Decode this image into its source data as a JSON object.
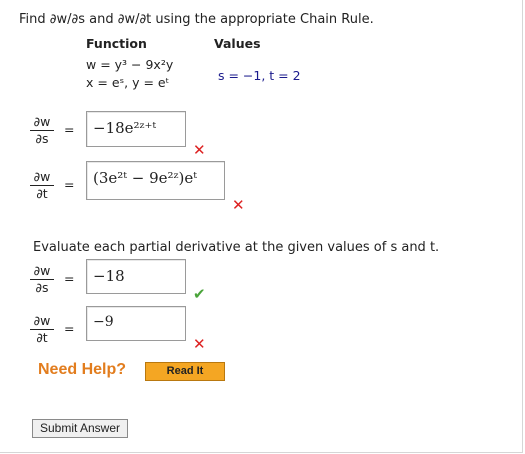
{
  "prompt": "Find ∂w/∂s and ∂w/∂t using the appropriate Chain Rule.",
  "table": {
    "function_header": "Function",
    "values_header": "Values",
    "function_line1": "w = y³ − 9x²y",
    "function_line2": "x = eˢ,  y = eᵗ",
    "values_text": "s = −1,  t = 2"
  },
  "part1": {
    "dw_ds_num": "∂w",
    "dw_ds_den": "∂s",
    "dw_dt_num": "∂w",
    "dw_dt_den": "∂t",
    "equals": "=",
    "answer_ds": "−18e²ᶻ⁺ᵗ",
    "answer_dt": "(3e²ᵗ − 9e²ᶻ)eᵗ",
    "ds_status": "incorrect",
    "dt_status": "incorrect"
  },
  "evaluate_text": "Evaluate each partial derivative at the given values of s and t.",
  "part2": {
    "dw_ds_num": "∂w",
    "dw_ds_den": "∂s",
    "dw_dt_num": "∂w",
    "dw_dt_den": "∂t",
    "equals": "=",
    "value_ds": "−18",
    "value_dt": "−9",
    "ds_status": "correct",
    "dt_status": "incorrect"
  },
  "help": {
    "label": "Need Help?",
    "read_it": "Read It"
  },
  "submit_label": "Submit Answer",
  "icons": {
    "incorrect": "x-mark-icon",
    "correct": "check-mark-icon"
  },
  "colors": {
    "incorrect": "#dd2222",
    "correct": "#4aa43a",
    "help_text": "#e27d1e",
    "read_it_button": "#f4a623"
  }
}
